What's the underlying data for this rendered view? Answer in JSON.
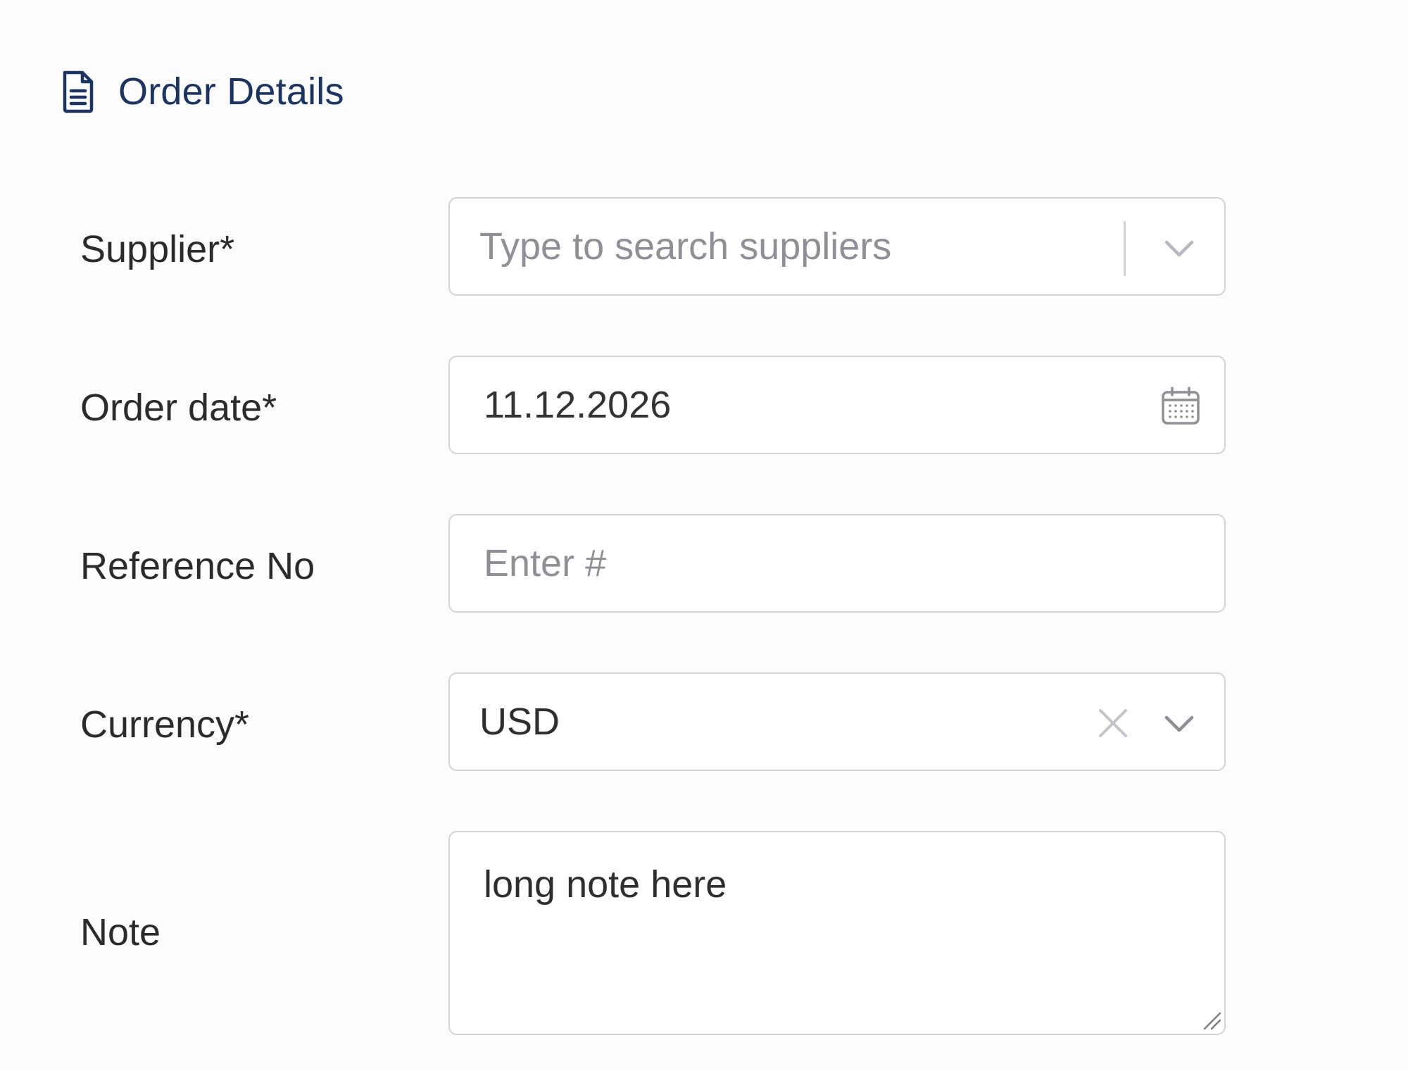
{
  "section": {
    "title": "Order Details",
    "icon": "document-icon",
    "accent_color": "#1d3461"
  },
  "form": {
    "supplier": {
      "label": "Supplier*",
      "placeholder": "Type to search suppliers",
      "value": ""
    },
    "order_date": {
      "label": "Order date*",
      "value": "11.12.2026",
      "icon": "calendar-icon"
    },
    "reference_no": {
      "label": "Reference No",
      "placeholder": "Enter #",
      "value": ""
    },
    "currency": {
      "label": "Currency*",
      "value": "USD"
    },
    "note": {
      "label": "Note",
      "value": "long note here"
    }
  }
}
